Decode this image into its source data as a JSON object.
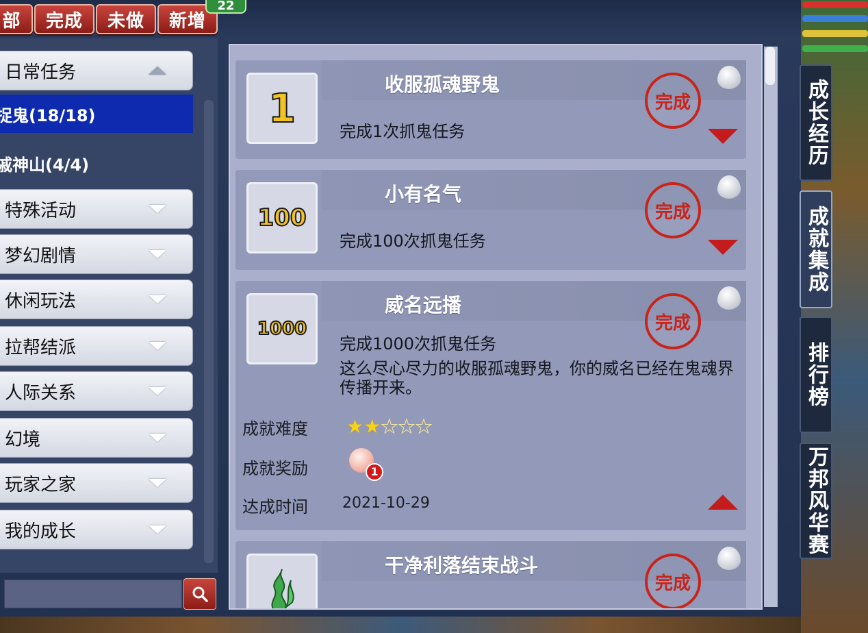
{
  "filters": {
    "all_partial": "部",
    "done": "完成",
    "undone": "未做",
    "new": "新增",
    "new_count": "22"
  },
  "sidebar": {
    "expanded_category": "日常任务",
    "selected_sub": "捉鬼(18/18)",
    "second_sub": "戚神山(4/4)",
    "categories": [
      "特殊活动",
      "梦幻剧情",
      "休闲玩法",
      "拉帮结派",
      "人际关系",
      "幻境",
      "玩家之家",
      "我的成长"
    ]
  },
  "achievements": [
    {
      "icon": "1",
      "title": "收服孤魂野鬼",
      "desc": "完成1次抓鬼任务",
      "seal": "完成"
    },
    {
      "icon": "100",
      "title": "小有名气",
      "desc": "完成100次抓鬼任务",
      "seal": "完成"
    },
    {
      "icon": "1000",
      "title": "威名远播",
      "desc": "完成1000次抓鬼任务",
      "extra": "这么尽心尽力的收服孤魂野鬼，你的威名已经在鬼魂界传播开来。",
      "seal": "完成",
      "difficulty_label": "成就难度",
      "difficulty_stars": 2,
      "difficulty_max": 5,
      "reward_label": "成就奖励",
      "reward_count": "1",
      "time_label": "达成时间",
      "time_value": "2021-10-29"
    },
    {
      "icon": "flame-icon",
      "title": "干净利落结束战斗",
      "seal": "完成"
    }
  ],
  "right_tabs": [
    "成长经历",
    "成就集成",
    "排行榜",
    "万邦风华赛"
  ],
  "colors": {
    "accent_red": "#c8241b",
    "selected_blue": "#0e2bb0",
    "star": "#f7d21a"
  }
}
